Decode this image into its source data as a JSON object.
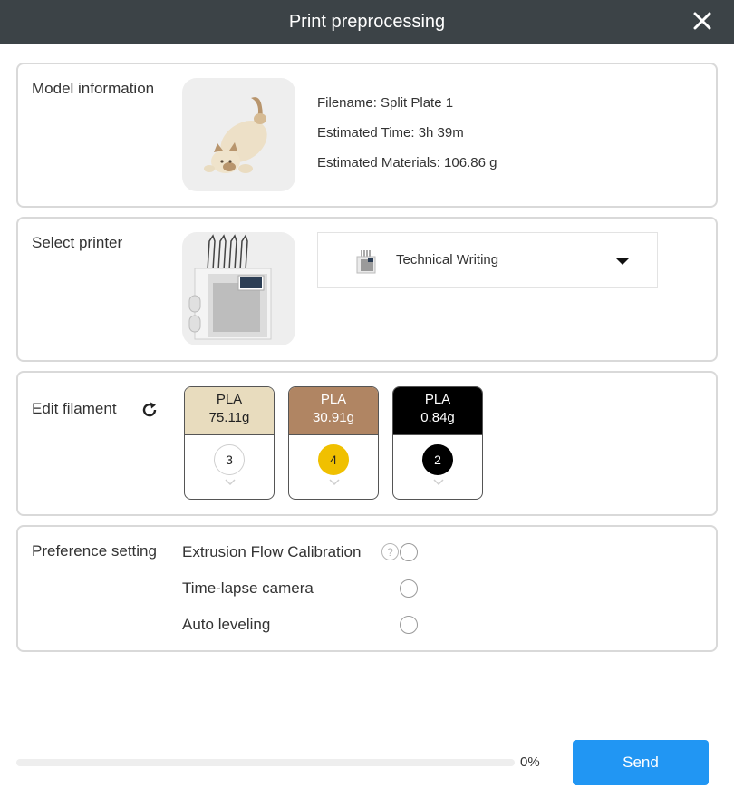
{
  "dialog": {
    "title": "Print preprocessing"
  },
  "model": {
    "label": "Model information",
    "filename": "Filename: Split Plate 1",
    "time": "Estimated Time: 3h 39m",
    "materials": "Estimated Materials: 106.86 g"
  },
  "printer": {
    "label": "Select printer",
    "selected": "Technical Writing"
  },
  "filament": {
    "label": "Edit filament",
    "items": [
      {
        "type": "PLA",
        "weight": "75.11g",
        "slot": "3",
        "color": "#e8dcbe",
        "text_color": "#222222",
        "slot_color": "#ffffff",
        "slot_text": "#222222"
      },
      {
        "type": "PLA",
        "weight": "30.91g",
        "slot": "4",
        "color": "#b08563",
        "text_color": "#ffffff",
        "slot_color": "#f0c000",
        "slot_text": "#222222"
      },
      {
        "type": "PLA",
        "weight": "0.84g",
        "slot": "2",
        "color": "#000000",
        "text_color": "#ffffff",
        "slot_color": "#000000",
        "slot_text": "#ffffff"
      }
    ]
  },
  "preferences": {
    "label": "Preference setting",
    "items": [
      {
        "label": "Extrusion Flow Calibration",
        "checked": false
      },
      {
        "label": "Time-lapse camera",
        "checked": false
      },
      {
        "label": "Auto leveling",
        "checked": false
      }
    ],
    "help_glyph": "?"
  },
  "footer": {
    "progress_percent": 0,
    "progress_label": "0%",
    "send_label": "Send"
  },
  "colors": {
    "titlebar": "#3c4347",
    "accent": "#2196f3"
  }
}
